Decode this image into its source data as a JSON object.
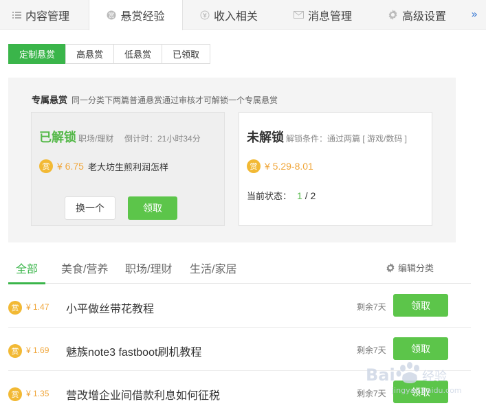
{
  "top_tabs": [
    {
      "label": "内容管理",
      "icon": "list-icon"
    },
    {
      "label": "悬赏经验",
      "icon": "reward-icon",
      "active": true
    },
    {
      "label": "收入相关",
      "icon": "yen-icon"
    },
    {
      "label": "消息管理",
      "icon": "envelope-icon"
    },
    {
      "label": "高级设置",
      "icon": "gear-icon"
    }
  ],
  "more_label": "»",
  "sub_tabs": [
    {
      "label": "定制悬赏",
      "active": true
    },
    {
      "label": "高悬赏"
    },
    {
      "label": "低悬赏"
    },
    {
      "label": "已领取"
    }
  ],
  "exclusive": {
    "title": "专属悬赏",
    "desc": "同一分类下两篇普通悬赏通过审核才可解锁一个专属悬赏",
    "unlocked": {
      "title": "已解锁",
      "category": "职场/理财",
      "countdown": "倒计时：21小时34分",
      "badge": "赏",
      "amount": "¥ 6.75",
      "question": "老大坊生煎利润怎样",
      "change_label": "换一个",
      "claim_label": "领取"
    },
    "locked": {
      "title": "未解锁",
      "condition": "解锁条件：通过两篇 [ 游戏/数码 ]",
      "badge": "赏",
      "amount": "¥ 5.29-8.01",
      "status_label": "当前状态：",
      "status_current": "1",
      "status_total": " / 2"
    }
  },
  "category_tabs": [
    {
      "label": "全部",
      "active": true
    },
    {
      "label": "美食/营养"
    },
    {
      "label": "职场/理财"
    },
    {
      "label": "生活/家居"
    }
  ],
  "edit_category_label": "编辑分类",
  "tasks": [
    {
      "badge": "赏",
      "amount": "¥ 1.47",
      "title": "小平做丝带花教程",
      "remain": "剩余7天",
      "claim": "领取"
    },
    {
      "badge": "赏",
      "amount": "¥ 1.69",
      "title": "魅族note3 fastboot刷机教程",
      "remain": "剩余7天",
      "claim": "领取"
    },
    {
      "badge": "赏",
      "amount": "¥ 1.35",
      "title": "营改增企业间借款利息如何征税",
      "remain": "剩余7天",
      "claim": "领取"
    }
  ],
  "watermark": {
    "text": "Baidu经验",
    "sub": "jingyan.baidu.com"
  },
  "colors": {
    "accent": "#3ab54a",
    "button": "#5cc54a",
    "reward": "#f0a63a",
    "badge": "#f2b934"
  }
}
